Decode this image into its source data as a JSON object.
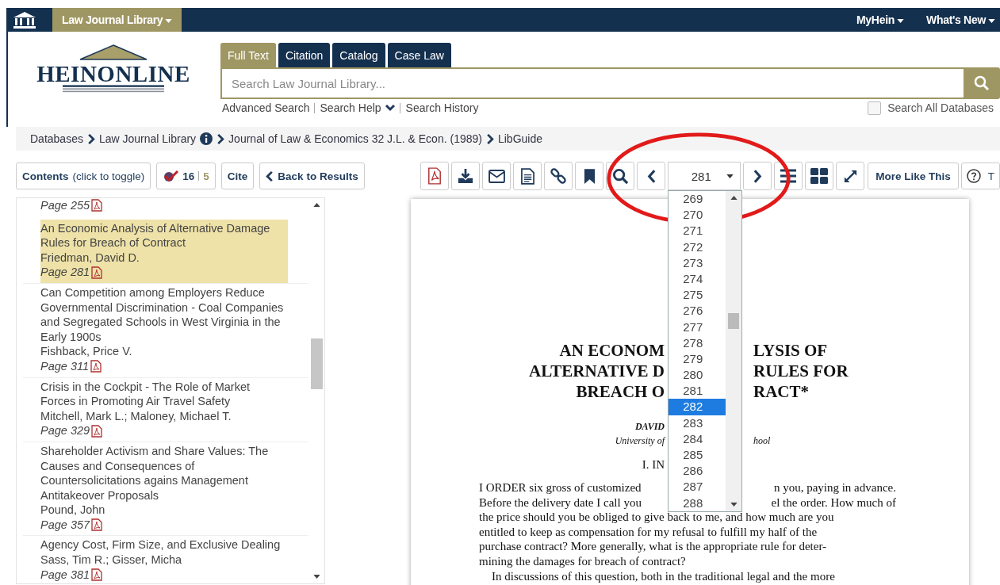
{
  "topbar": {
    "library_menu": "Law Journal Library",
    "links": [
      "MyHein",
      "What's New"
    ]
  },
  "logo": {
    "text": "HEINONLINE"
  },
  "search": {
    "tabs": [
      {
        "label": "Full Text",
        "selected": true
      },
      {
        "label": "Citation",
        "selected": false
      },
      {
        "label": "Catalog",
        "selected": false
      },
      {
        "label": "Case Law",
        "selected": false
      }
    ],
    "placeholder": "Search Law Journal Library...",
    "links": [
      "Advanced Search",
      "Search Help",
      "Search History"
    ],
    "search_all": {
      "label": "Search All Databases",
      "checked": false
    }
  },
  "breadcrumbs": [
    "Databases",
    "Law Journal Library",
    "Journal of Law & Economics 32 J.L. & Econ. (1989)",
    "LibGuide"
  ],
  "left_toolbar": {
    "contents": "Contents",
    "contents_hint": "(click to toggle)",
    "count_a": "16",
    "count_b": "5",
    "cite": "Cite",
    "back": "Back to Results"
  },
  "contents": [
    {
      "page": "Page 255",
      "selected": false
    },
    {
      "title": "An Economic Analysis of Alternative Damage Rules for Breach of Contract",
      "authors": "Friedman, David D.",
      "page": "Page 281",
      "selected": true
    },
    {
      "title": "Can Competition among Employers Reduce Governmental Discrimination - Coal Companies and Segregated Schools in West Virginia in the Early 1900s",
      "authors": "Fishback, Price V.",
      "page": "Page 311",
      "selected": false
    },
    {
      "title": "Crisis in the Cockpit - The Role of Market Forces in Promoting Air Travel Safety",
      "authors": "Mitchell, Mark L.; Maloney, Michael T.",
      "page": "Page 329",
      "selected": false
    },
    {
      "title": "Shareholder Activism and Share Values: The Causes and Consequences of Countersolicitations agains Management Antitakeover Proposals",
      "authors": "Pound, John",
      "page": "Page 357",
      "selected": false
    },
    {
      "title": "Agency Cost, Firm Size, and Exclusive Dealing",
      "authors": "Sass, Tim R.; Gisser, Micha",
      "page": "Page 381",
      "selected": false
    }
  ],
  "viewer_toolbar": {
    "page_select": "281",
    "more_like_this": "More Like This",
    "help": "T"
  },
  "page_dropdown": [
    {
      "label": "269",
      "selected": false
    },
    {
      "label": "270",
      "selected": false
    },
    {
      "label": "271",
      "selected": false
    },
    {
      "label": "272",
      "selected": false
    },
    {
      "label": "273",
      "selected": false
    },
    {
      "label": "274",
      "selected": false
    },
    {
      "label": "275",
      "selected": false
    },
    {
      "label": "276",
      "selected": false
    },
    {
      "label": "277",
      "selected": false
    },
    {
      "label": "278",
      "selected": false
    },
    {
      "label": "279",
      "selected": false
    },
    {
      "label": "280",
      "selected": false
    },
    {
      "label": "281",
      "selected": false
    },
    {
      "label": "282",
      "selected": true
    },
    {
      "label": "283",
      "selected": false
    },
    {
      "label": "284",
      "selected": false
    },
    {
      "label": "285",
      "selected": false
    },
    {
      "label": "286",
      "selected": false
    },
    {
      "label": "287",
      "selected": false
    },
    {
      "label": "288",
      "selected": false
    }
  ],
  "document": {
    "lines": [
      {
        "kind": "title",
        "left": "AN ECONOM",
        "right": "LYSIS OF"
      },
      {
        "kind": "title",
        "left": "ALTERNATIVE D",
        "right": "RULES FOR"
      },
      {
        "kind": "title",
        "left": "BREACH O",
        "right": "RACT*"
      },
      {
        "kind": "author",
        "left": "DAVID"
      },
      {
        "kind": "affiliation",
        "left": "University of",
        "right": "hool"
      },
      {
        "kind": "section",
        "left": "I.   IN"
      },
      {
        "kind": "body",
        "left": "I ORDER six gross of customized",
        "right": "n you, paying in advance."
      },
      {
        "kind": "body",
        "left": "Before the delivery date I call you",
        "right": "el the order. How much of"
      },
      {
        "kind": "full",
        "left": "the price should you be obliged to give back to me, and how much are you"
      },
      {
        "kind": "full",
        "left": "entitled to keep as compensation for my refusal to fulfill my half of the"
      },
      {
        "kind": "full",
        "left": "purchase contract? More generally, what is the appropriate rule for deter-"
      },
      {
        "kind": "full",
        "left": "mining the damages for breach of contract?"
      },
      {
        "kind": "indent",
        "left": "In discussions of this question, both in the traditional legal and the more"
      }
    ]
  }
}
